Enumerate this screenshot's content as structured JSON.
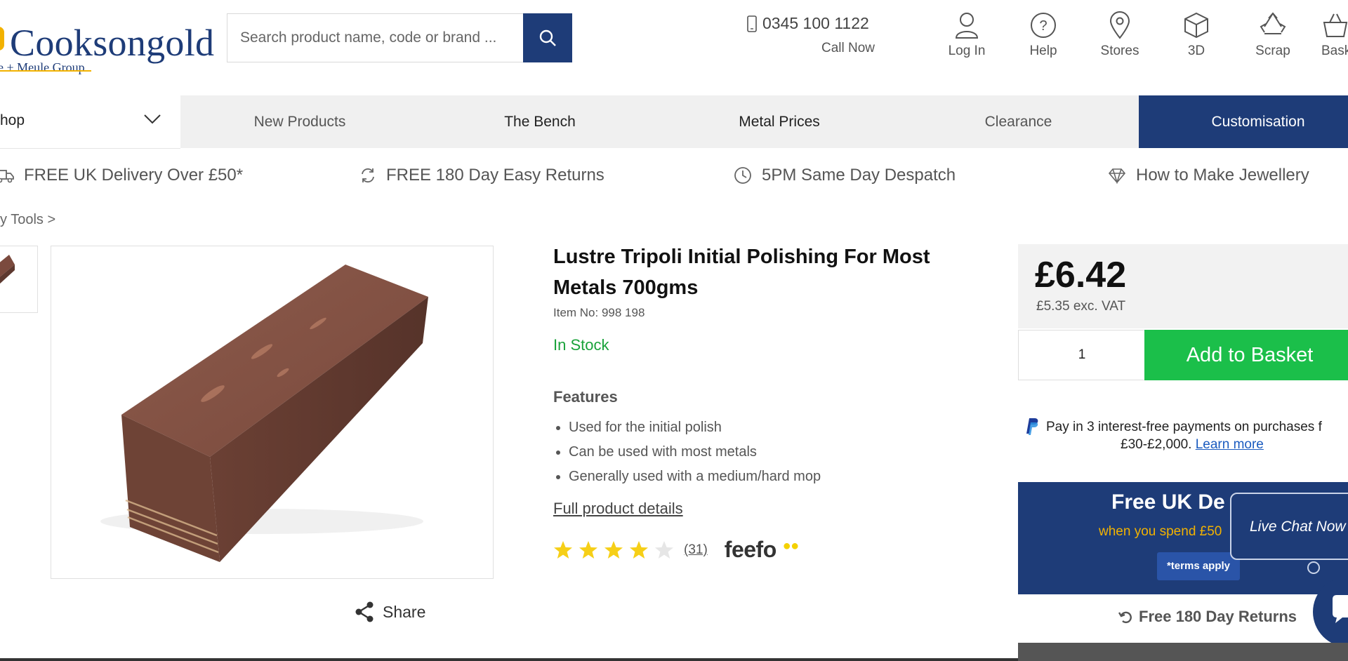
{
  "header": {
    "brand": "Cooksongold",
    "brand_sub": "le + Meule Group",
    "search_placeholder": "Search product name, code or brand ...",
    "phone": "0345 100 1122",
    "call_now": "Call Now",
    "icons": [
      {
        "label": "Log In",
        "icon": "user-icon"
      },
      {
        "label": "Help",
        "icon": "help-icon"
      },
      {
        "label": "Stores",
        "icon": "location-pin-icon"
      },
      {
        "label": "3D",
        "icon": "cube-icon"
      },
      {
        "label": "Scrap",
        "icon": "recycle-icon"
      },
      {
        "label": "Bask",
        "icon": "basket-icon"
      }
    ]
  },
  "nav": {
    "shop": "hop",
    "items": [
      "New Products",
      "The Bench",
      "Metal Prices",
      "Clearance"
    ],
    "customisation": "Customisation"
  },
  "usp": [
    {
      "text": "FREE UK Delivery Over £50*",
      "icon": "truck-icon"
    },
    {
      "text": "FREE 180 Day Easy Returns",
      "icon": "refresh-icon"
    },
    {
      "text": "5PM Same Day Despatch",
      "icon": "clock-icon"
    },
    {
      "text": "How to Make Jewellery",
      "icon": "diamond-icon"
    }
  ],
  "breadcrumb": "y Tools  >",
  "product": {
    "title": "Lustre Tripoli Initial Polishing For Most Metals 700gms",
    "item_no": "Item No: 998 198",
    "stock": "In Stock",
    "features_heading": "Features",
    "features": [
      "Used for the initial polish",
      "Can be used with most metals",
      "Generally used with a medium/hard mop"
    ],
    "full_details": "Full product details",
    "rating": 4,
    "rating_max": 5,
    "review_count": "(31)",
    "review_brand": "feefo",
    "share": "Share"
  },
  "buy": {
    "price": "£6.42",
    "ex_vat": "£5.35 exc. VAT",
    "qty": "1",
    "add_to_basket": "Add to Basket",
    "paypal_line1": "Pay in 3 interest-free payments on purchases f",
    "paypal_line2": "£30-£2,000.",
    "paypal_learn": "Learn more"
  },
  "banner": {
    "title": "Free UK De",
    "subtitle": "when you spend £50",
    "terms": "*terms apply"
  },
  "chat": {
    "label": "Live Chat Now"
  },
  "returns": "Free 180 Day Returns",
  "colors": {
    "brand_navy": "#1e3c78",
    "accent_gold": "#f2b200",
    "cta_green": "#1bbf4a",
    "stock_green": "#19a23a",
    "star_yellow": "#f6cf17"
  }
}
